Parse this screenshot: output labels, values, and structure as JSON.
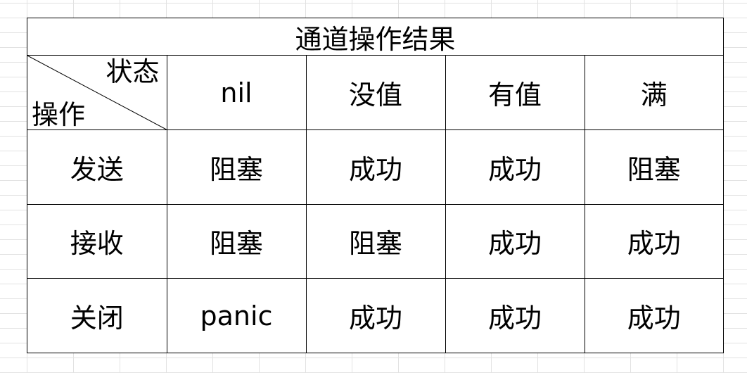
{
  "table": {
    "title": "通道操作结果",
    "corner": {
      "top_right": "状态",
      "bottom_left": "操作"
    },
    "columns": [
      "nil",
      "没值",
      "有值",
      "满"
    ],
    "rows": [
      {
        "header": "发送",
        "cells": [
          "阻塞",
          "成功",
          "成功",
          "阻塞"
        ]
      },
      {
        "header": "接收",
        "cells": [
          "阻塞",
          "阻塞",
          "成功",
          "成功"
        ]
      },
      {
        "header": "关闭",
        "cells": [
          "panic",
          "成功",
          "成功",
          "成功"
        ]
      }
    ]
  }
}
